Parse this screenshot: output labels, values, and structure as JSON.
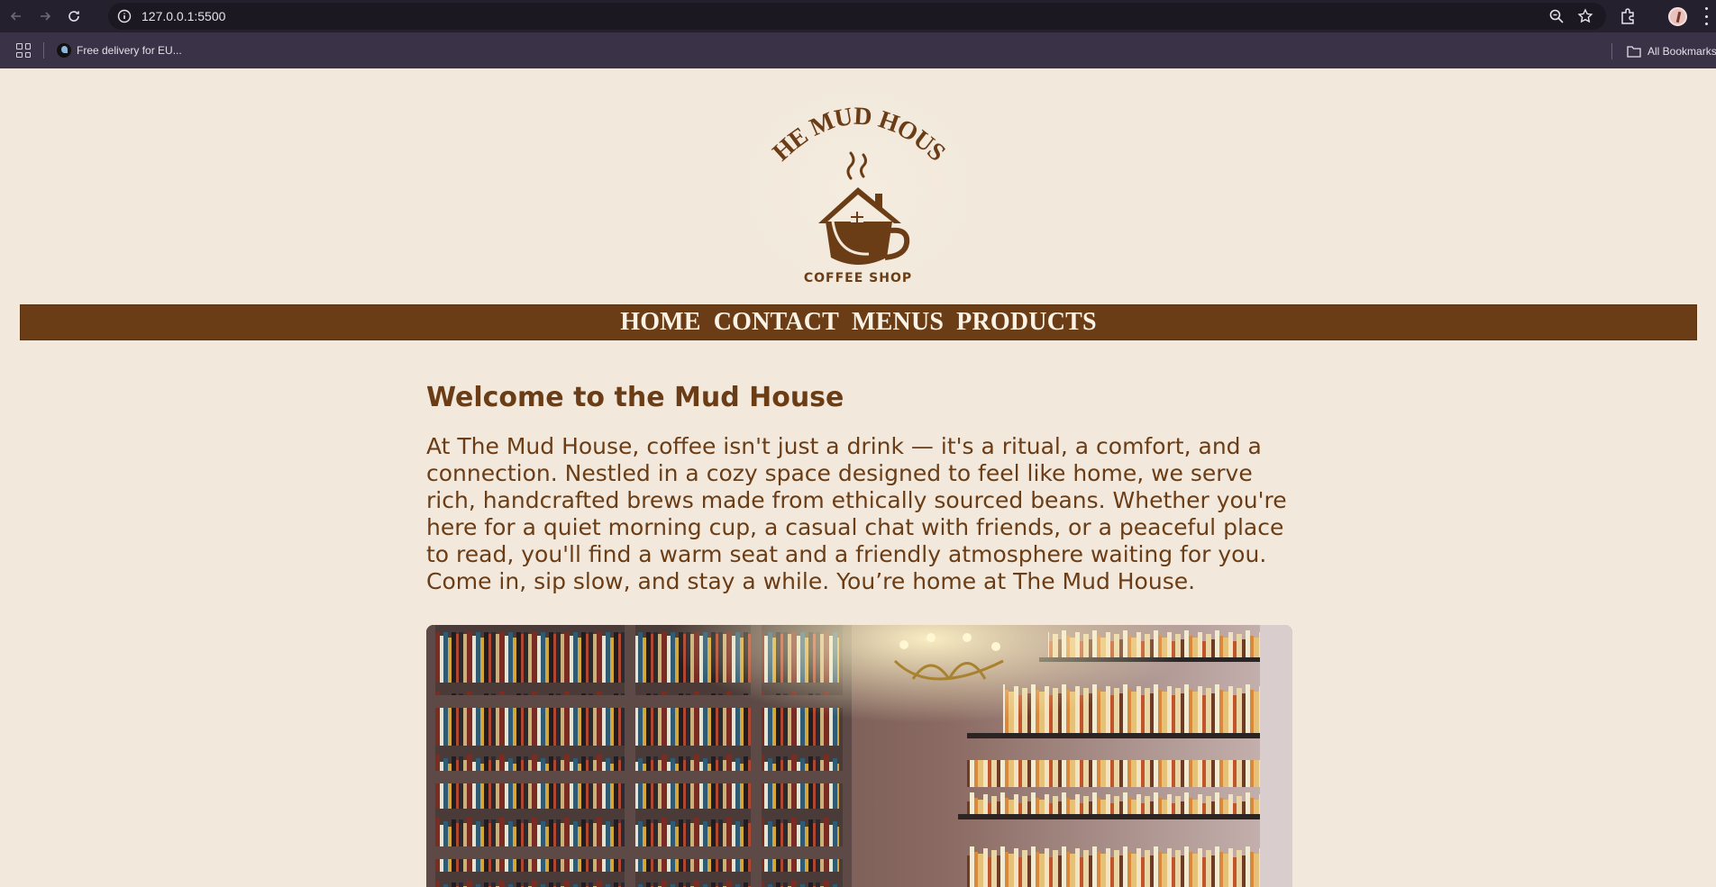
{
  "browser": {
    "url": "127.0.0.1:5500",
    "bookmark_label": "Free delivery for EU...",
    "all_bookmarks_label": "All Bookmarks"
  },
  "logo": {
    "arc_text": "THE MUD HOUSE",
    "sub_text": "COFFEE SHOP"
  },
  "nav": {
    "items": [
      "HOME",
      "CONTACT",
      "MENUS",
      "PRODUCTS"
    ]
  },
  "main": {
    "heading": "Welcome to the Mud House",
    "intro": "At The Mud House, coffee isn't just a drink — it's a ritual, a comfort, and a connection. Nestled in a cozy space designed to feel like home, we serve rich, handcrafted brews made from ethically sourced beans. Whether you're here for a quiet morning cup, a casual chat with friends, or a peaceful place to read, you'll find a warm seat and a friendly atmosphere waiting for you. Come in, sip slow, and stay a while. You’re home at The Mud House."
  },
  "colors": {
    "brand_brown": "#6b3d16",
    "page_bg": "#f2e9dc",
    "nav_text": "#fbf3e6"
  }
}
